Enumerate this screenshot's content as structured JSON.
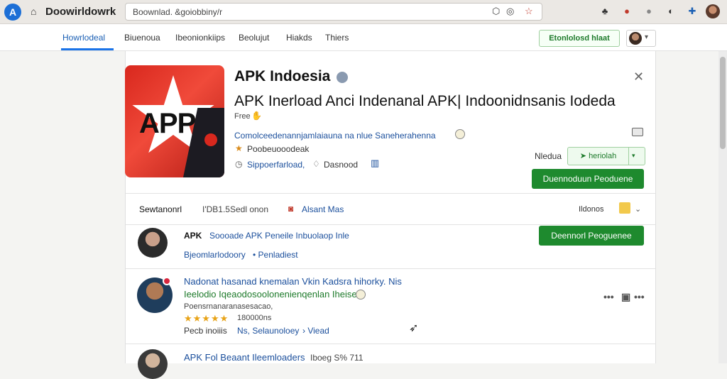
{
  "browser": {
    "app_logo_letter": "A",
    "app_title": "Doowirldowrk",
    "url": "Boownlad. &goiobbiny/r"
  },
  "nav": {
    "tabs": [
      "Howrlodeal",
      "Biuenoua",
      "Ibeonionkiips",
      "Beolujut",
      "Hiakds",
      "Thiers"
    ],
    "download_button": "Etonlolosd hlaat"
  },
  "app": {
    "name": "APK Indoesia",
    "icon_text": "APP",
    "subtitle": "APK Inerload Anci Indenanal APK| Indoonidnsanis Iodeda",
    "price": "Free",
    "info_line": "Comolceedenannjamlaiauna na nlue Saneherahenna",
    "info_line2": "Poobeuooodeak",
    "info_line3": "Sippoerfarload,",
    "info_line3b": "Dasnood",
    "mode_label": "Nledua",
    "split_button": "heriolah",
    "download_button": "Duennoduun Peoduene"
  },
  "reviews_tabs": {
    "tab1": "Sewtanonrl",
    "tab2": "I'DB1.5Sedl onon",
    "tab3": "Alsant Mas",
    "sort_label": "Ildonos"
  },
  "reviews": [
    {
      "title_a": "APK",
      "title_b": "Soooade APK Peneile Inbuolaop Inle",
      "link_a": "Bjeomlarlodoory",
      "link_b": "Penladiest",
      "button": "Deennorl Peoguenee"
    },
    {
      "title": "Nadonat  hasanad knemalan  Vkin Kadsra  hihorky. Nis",
      "subtitle": "Ieelodio  Iqeaodosoolonenienqenlan Iheise.",
      "meta": "Poensrnanaranasesacao,",
      "rating_stars": "★★★★★",
      "rating_count": "180000ns",
      "footer_a": "Pecb inoiiis",
      "footer_b": "Ns, Selaunoloey",
      "footer_c": "Viead"
    },
    {
      "title": "APK Fol Beaant  Ileemloaders",
      "meta": "Iboeg S% 711"
    }
  ]
}
